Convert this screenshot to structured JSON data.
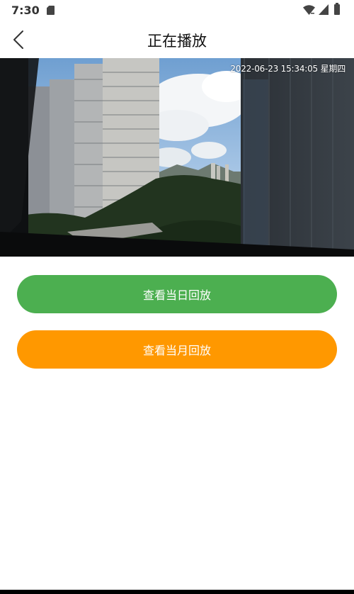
{
  "status_bar": {
    "time": "7:30",
    "icons": [
      "sd-card-icon",
      "wifi-icon",
      "signal-icon",
      "battery-icon"
    ]
  },
  "header": {
    "back_icon": "chevron-left-icon",
    "title": "正在播放"
  },
  "video": {
    "timestamp": "2022-06-23 15:34:05 星期四"
  },
  "buttons": {
    "day_playback": "查看当日回放",
    "month_playback": "查看当月回放"
  },
  "colors": {
    "day_button": "#4CAF50",
    "month_button": "#FF9800",
    "background": "#FFFFFF",
    "title_text": "#111111"
  }
}
